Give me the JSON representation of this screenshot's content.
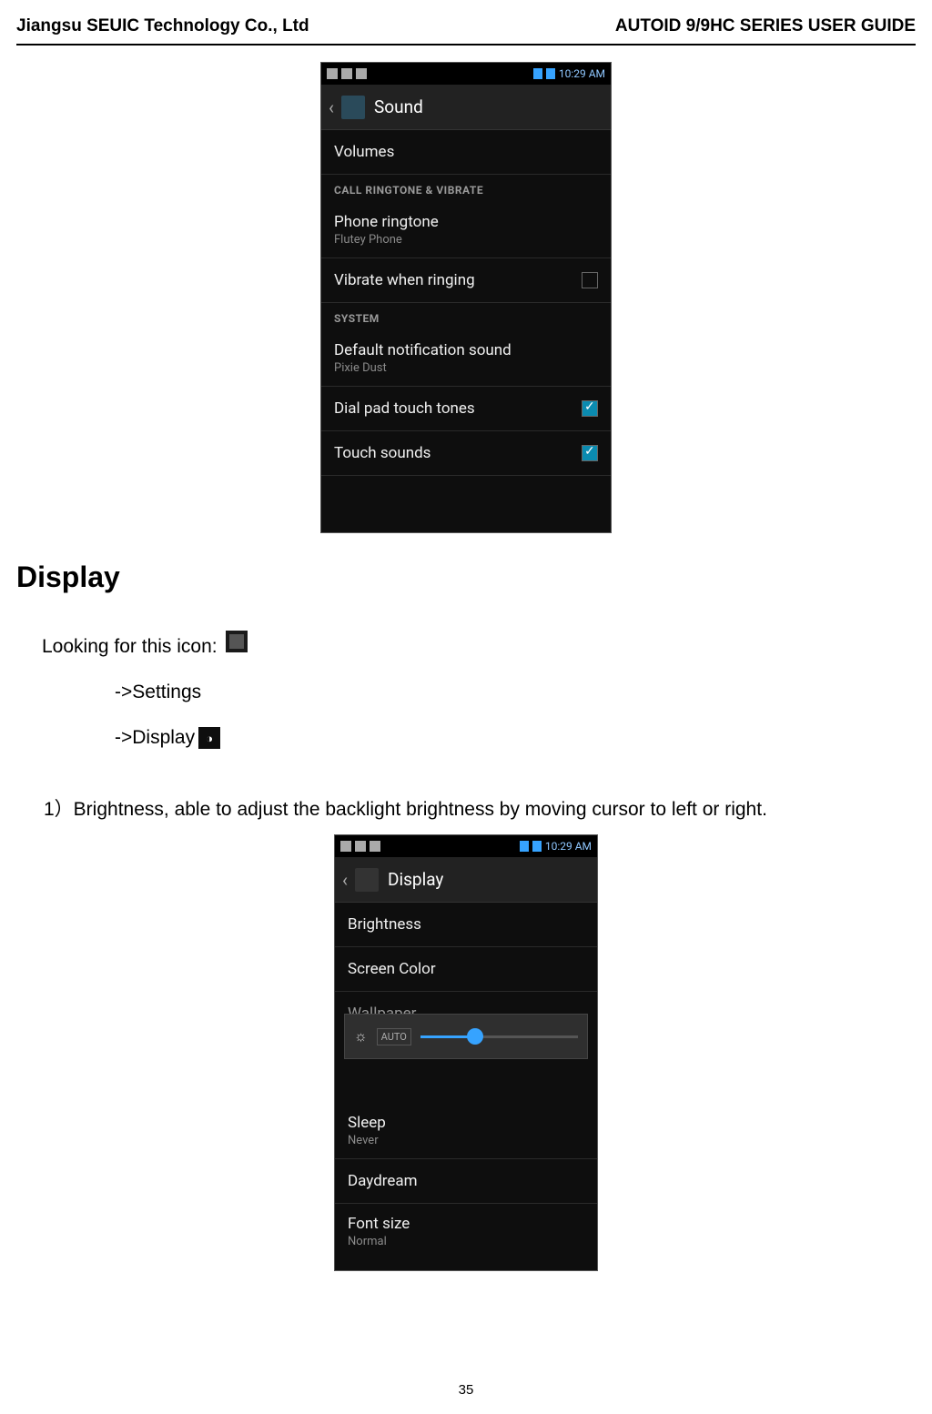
{
  "header": {
    "left": "Jiangsu SEUIC Technology Co., Ltd",
    "right": "AUTOID 9/9HC SERIES USER GUIDE"
  },
  "page_number": "35",
  "screenshot1": {
    "status_time": "10:29 AM",
    "app_title": "Sound",
    "rows": {
      "volumes": "Volumes",
      "section_ringtone": "CALL RINGTONE & VIBRATE",
      "phone_ringtone_label": "Phone ringtone",
      "phone_ringtone_value": "Flutey Phone",
      "vibrate_label": "Vibrate when ringing",
      "section_system": "SYSTEM",
      "default_notif_label": "Default notification sound",
      "default_notif_value": "Pixie Dust",
      "dial_pad_label": "Dial pad touch tones",
      "touch_sounds_label": "Touch sounds"
    }
  },
  "section_title": "Display",
  "looking_text": "Looking for this icon:",
  "nav_settings": "->Settings",
  "nav_display": "->Display",
  "step1": "1）Brightness, able to adjust the backlight brightness by moving cursor to left or right.",
  "screenshot2": {
    "status_time": "10:29 AM",
    "app_title": "Display",
    "rows": {
      "brightness": "Brightness",
      "screen_color": "Screen Color",
      "wallpaper": "Wallpaper",
      "auto": "AUTO",
      "sleep_label": "Sleep",
      "sleep_value": "Never",
      "daydream": "Daydream",
      "font_label": "Font size",
      "font_value": "Normal"
    }
  }
}
